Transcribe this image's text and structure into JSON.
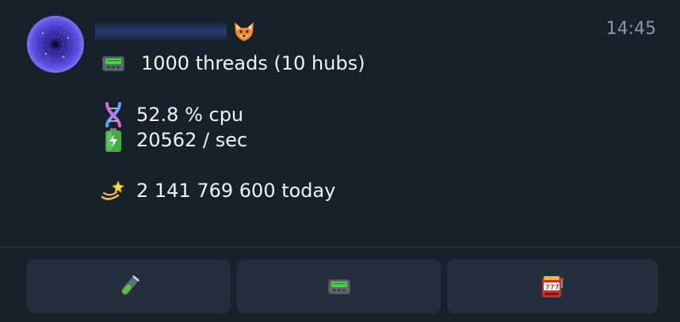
{
  "message": {
    "sender": {
      "avatar_icon": "galaxy-avatar-icon",
      "name_redacted": true,
      "emoji_icon": "fox-face-icon"
    },
    "timestamp": "14:45",
    "lines": [
      {
        "icon": "pager-icon",
        "text": "1000 threads (10 hubs)"
      },
      {
        "icon": "dna-icon",
        "text": "52.8 % cpu"
      },
      {
        "icon": "battery-icon",
        "text": "20562 / sec"
      },
      {
        "icon": "dizzy-icon",
        "text": "2 141 769 600 today"
      }
    ]
  },
  "inline_buttons": [
    {
      "icon": "test-tube-icon"
    },
    {
      "icon": "pager-icon"
    },
    {
      "icon": "slot-machine-icon"
    }
  ],
  "colors": {
    "background": "#17212b",
    "button_background": "#232f3d",
    "timestamp": "#8b97a6",
    "text": "#f2f4f6"
  }
}
